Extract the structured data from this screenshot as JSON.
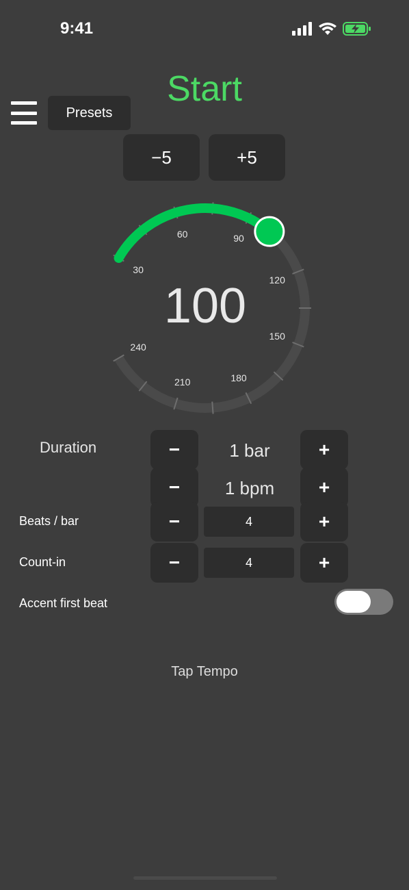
{
  "status_bar": {
    "time": "9:41",
    "icons": [
      "signal-icon",
      "wifi-icon",
      "battery-charging-icon"
    ],
    "battery_color": "#4cd964"
  },
  "header": {
    "menu_icon": "hamburger-icon",
    "presets_label": "Presets",
    "start_label": "Start",
    "start_color": "#4cd964",
    "minus_five_label": "−5",
    "plus_five_label": "+5"
  },
  "dial": {
    "value": "100",
    "min": 30,
    "max": 240,
    "current": 100,
    "accent_color": "#00c853",
    "tick_labels": [
      "30",
      "60",
      "90",
      "120",
      "150",
      "180",
      "210",
      "240"
    ]
  },
  "duration": {
    "label": "Duration",
    "bars_value": "1 bar",
    "bpm_value": "1 bpm",
    "minus_label": "−",
    "plus_label": "+"
  },
  "beats_per_bar": {
    "label": "Beats / bar",
    "value": "4",
    "minus_label": "−",
    "plus_label": "+"
  },
  "count_in": {
    "label": "Count-in",
    "value": "4",
    "minus_label": "−",
    "plus_label": "+"
  },
  "accent_first_beat": {
    "label": "Accent first beat",
    "enabled": false
  },
  "tap_tempo": {
    "label": "Tap Tempo"
  }
}
